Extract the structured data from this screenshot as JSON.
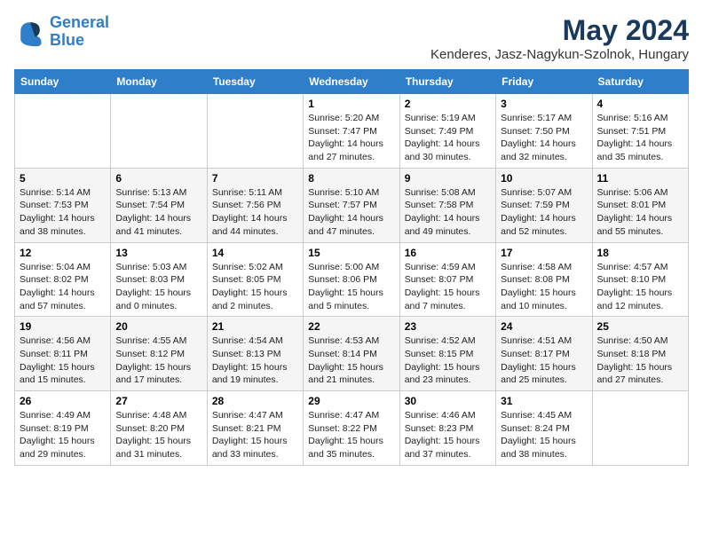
{
  "logo": {
    "line1": "General",
    "line2": "Blue"
  },
  "title": "May 2024",
  "location": "Kenderes, Jasz-Nagykun-Szolnok, Hungary",
  "weekdays": [
    "Sunday",
    "Monday",
    "Tuesday",
    "Wednesday",
    "Thursday",
    "Friday",
    "Saturday"
  ],
  "weeks": [
    [
      {
        "day": "",
        "info": ""
      },
      {
        "day": "",
        "info": ""
      },
      {
        "day": "",
        "info": ""
      },
      {
        "day": "1",
        "info": "Sunrise: 5:20 AM\nSunset: 7:47 PM\nDaylight: 14 hours\nand 27 minutes."
      },
      {
        "day": "2",
        "info": "Sunrise: 5:19 AM\nSunset: 7:49 PM\nDaylight: 14 hours\nand 30 minutes."
      },
      {
        "day": "3",
        "info": "Sunrise: 5:17 AM\nSunset: 7:50 PM\nDaylight: 14 hours\nand 32 minutes."
      },
      {
        "day": "4",
        "info": "Sunrise: 5:16 AM\nSunset: 7:51 PM\nDaylight: 14 hours\nand 35 minutes."
      }
    ],
    [
      {
        "day": "5",
        "info": "Sunrise: 5:14 AM\nSunset: 7:53 PM\nDaylight: 14 hours\nand 38 minutes."
      },
      {
        "day": "6",
        "info": "Sunrise: 5:13 AM\nSunset: 7:54 PM\nDaylight: 14 hours\nand 41 minutes."
      },
      {
        "day": "7",
        "info": "Sunrise: 5:11 AM\nSunset: 7:56 PM\nDaylight: 14 hours\nand 44 minutes."
      },
      {
        "day": "8",
        "info": "Sunrise: 5:10 AM\nSunset: 7:57 PM\nDaylight: 14 hours\nand 47 minutes."
      },
      {
        "day": "9",
        "info": "Sunrise: 5:08 AM\nSunset: 7:58 PM\nDaylight: 14 hours\nand 49 minutes."
      },
      {
        "day": "10",
        "info": "Sunrise: 5:07 AM\nSunset: 7:59 PM\nDaylight: 14 hours\nand 52 minutes."
      },
      {
        "day": "11",
        "info": "Sunrise: 5:06 AM\nSunset: 8:01 PM\nDaylight: 14 hours\nand 55 minutes."
      }
    ],
    [
      {
        "day": "12",
        "info": "Sunrise: 5:04 AM\nSunset: 8:02 PM\nDaylight: 14 hours\nand 57 minutes."
      },
      {
        "day": "13",
        "info": "Sunrise: 5:03 AM\nSunset: 8:03 PM\nDaylight: 15 hours\nand 0 minutes."
      },
      {
        "day": "14",
        "info": "Sunrise: 5:02 AM\nSunset: 8:05 PM\nDaylight: 15 hours\nand 2 minutes."
      },
      {
        "day": "15",
        "info": "Sunrise: 5:00 AM\nSunset: 8:06 PM\nDaylight: 15 hours\nand 5 minutes."
      },
      {
        "day": "16",
        "info": "Sunrise: 4:59 AM\nSunset: 8:07 PM\nDaylight: 15 hours\nand 7 minutes."
      },
      {
        "day": "17",
        "info": "Sunrise: 4:58 AM\nSunset: 8:08 PM\nDaylight: 15 hours\nand 10 minutes."
      },
      {
        "day": "18",
        "info": "Sunrise: 4:57 AM\nSunset: 8:10 PM\nDaylight: 15 hours\nand 12 minutes."
      }
    ],
    [
      {
        "day": "19",
        "info": "Sunrise: 4:56 AM\nSunset: 8:11 PM\nDaylight: 15 hours\nand 15 minutes."
      },
      {
        "day": "20",
        "info": "Sunrise: 4:55 AM\nSunset: 8:12 PM\nDaylight: 15 hours\nand 17 minutes."
      },
      {
        "day": "21",
        "info": "Sunrise: 4:54 AM\nSunset: 8:13 PM\nDaylight: 15 hours\nand 19 minutes."
      },
      {
        "day": "22",
        "info": "Sunrise: 4:53 AM\nSunset: 8:14 PM\nDaylight: 15 hours\nand 21 minutes."
      },
      {
        "day": "23",
        "info": "Sunrise: 4:52 AM\nSunset: 8:15 PM\nDaylight: 15 hours\nand 23 minutes."
      },
      {
        "day": "24",
        "info": "Sunrise: 4:51 AM\nSunset: 8:17 PM\nDaylight: 15 hours\nand 25 minutes."
      },
      {
        "day": "25",
        "info": "Sunrise: 4:50 AM\nSunset: 8:18 PM\nDaylight: 15 hours\nand 27 minutes."
      }
    ],
    [
      {
        "day": "26",
        "info": "Sunrise: 4:49 AM\nSunset: 8:19 PM\nDaylight: 15 hours\nand 29 minutes."
      },
      {
        "day": "27",
        "info": "Sunrise: 4:48 AM\nSunset: 8:20 PM\nDaylight: 15 hours\nand 31 minutes."
      },
      {
        "day": "28",
        "info": "Sunrise: 4:47 AM\nSunset: 8:21 PM\nDaylight: 15 hours\nand 33 minutes."
      },
      {
        "day": "29",
        "info": "Sunrise: 4:47 AM\nSunset: 8:22 PM\nDaylight: 15 hours\nand 35 minutes."
      },
      {
        "day": "30",
        "info": "Sunrise: 4:46 AM\nSunset: 8:23 PM\nDaylight: 15 hours\nand 37 minutes."
      },
      {
        "day": "31",
        "info": "Sunrise: 4:45 AM\nSunset: 8:24 PM\nDaylight: 15 hours\nand 38 minutes."
      },
      {
        "day": "",
        "info": ""
      }
    ]
  ]
}
